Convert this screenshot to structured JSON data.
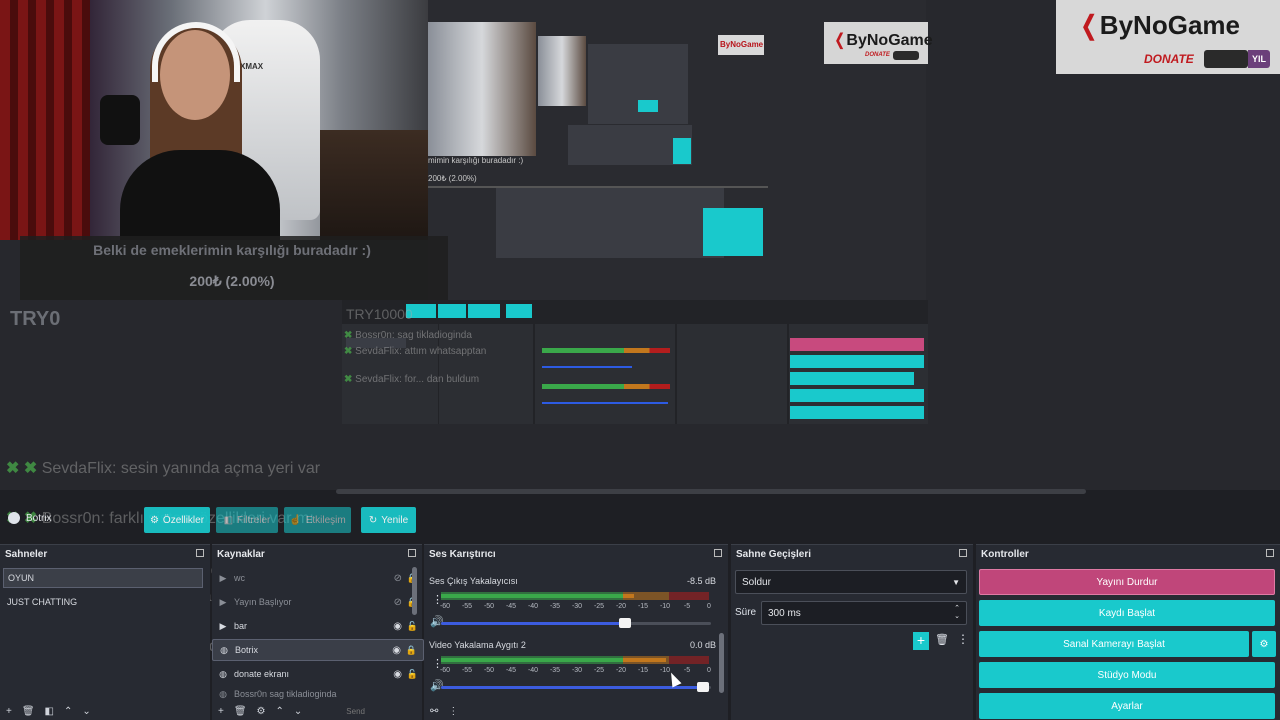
{
  "preview": {
    "donation_message": "Belki de emeklerimin karşılığı buradadır :)",
    "donation_amount": "200₺ (2.00%)",
    "try_label": "TRY0",
    "nested_try_label": "TRY10000",
    "chat_ghost": [
      {
        "user": "SevdaFlix",
        "text": ": sesin yanında açma yeri var"
      },
      {
        "user": "Bossr0n",
        "text": ": farklı sistem özellikleri var mı"
      },
      {
        "user": "Bossr0n",
        "text": ": sag tikladioginda"
      },
      {
        "user": "SevdaFlix",
        "text": ": attım whatsapptan"
      },
      {
        "user": "SevdaFlix",
        "text": ": for... dan buldum"
      }
    ],
    "logo": {
      "name_prefix": "By",
      "name_mid": "No",
      "name_suffix": "Game",
      "donate": "DONATE",
      "yil": "YIL"
    },
    "nested_logo_text": "ByNoGame",
    "webcam_brand": "XMAX",
    "nested_cam_caption": "mimin karşılığı buradadır :)",
    "nested_cam_amount": "200₺ (2.00%)"
  },
  "toolbar": {
    "source_name": "Botrix",
    "properties_label": "Özellikler",
    "filters_label": "Filtreler",
    "interact_label": "Etkileşim",
    "refresh_label": "Yenile"
  },
  "scenes": {
    "title": "Sahneler",
    "items": [
      "OYUN",
      "JUST CHATTING"
    ]
  },
  "sources": {
    "title": "Kaynaklar",
    "items": [
      {
        "label": "wc",
        "icon": "play-icon"
      },
      {
        "label": "Yayın Başlıyor",
        "icon": "play-icon"
      },
      {
        "label": "bar",
        "icon": "play-icon"
      },
      {
        "label": "Botrix",
        "icon": "globe-icon"
      },
      {
        "label": "donate ekranı",
        "icon": "globe-icon"
      },
      {
        "label": "Bossr0n sag tikladioginda",
        "icon": "globe-icon"
      }
    ],
    "send_label": "Send"
  },
  "mixer": {
    "title": "Ses Karıştırıcı",
    "channels": [
      {
        "name": "Ses Çıkış Yakalayıcısı",
        "db": "-8.5 dB",
        "level": 0.72,
        "volume": 0.68
      },
      {
        "name": "Video Yakalama Aygıtı 2",
        "db": "0.0 dB",
        "level": 0.84,
        "volume": 0.97
      }
    ],
    "ticks": [
      "-60",
      "-55",
      "-50",
      "-45",
      "-40",
      "-35",
      "-30",
      "-25",
      "-20",
      "-15",
      "-10",
      "-5",
      "0"
    ]
  },
  "transitions": {
    "title": "Sahne Geçişleri",
    "selected": "Soldur",
    "duration_label": "Süre",
    "duration_value": "300 ms"
  },
  "controls": {
    "title": "Kontroller",
    "stop_stream": "Yayını Durdur",
    "start_record": "Kaydı Başlat",
    "start_vcam": "Sanal Kamerayı Başlat",
    "studio_mode": "Stüdyo Modu",
    "settings": "Ayarlar"
  },
  "colors": {
    "accent": "#19c9cc",
    "stop": "#c0467a",
    "panel": "#272a32",
    "meter_green": "#3aa84a",
    "meter_orange": "#c2771d",
    "meter_red": "#b31d1d"
  }
}
